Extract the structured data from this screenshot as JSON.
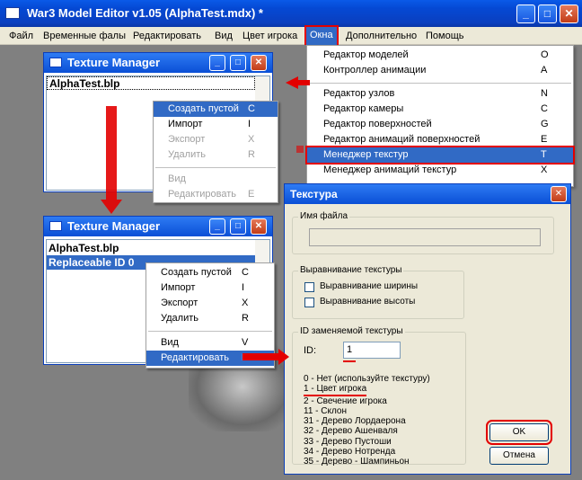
{
  "app": {
    "title": "War3 Model Editor v1.05 (AlphaTest.mdx) *",
    "window_controls": [
      "_",
      "□",
      "✕"
    ]
  },
  "menubar": [
    "Файл",
    "Временные фалы",
    "Редактировать",
    "Вид",
    "Цвет игрока",
    "Окна",
    "Дополнительно",
    "Помощь"
  ],
  "windows_menu": [
    {
      "label": "Редактор моделей",
      "key": "O"
    },
    {
      "label": "Контроллер анимации",
      "key": "A"
    },
    {
      "label": "Редактор узлов",
      "key": "N"
    },
    {
      "label": "Редактор камеры",
      "key": "C"
    },
    {
      "label": "Редактор поверхностей",
      "key": "G"
    },
    {
      "label": "Редактор анимаций поверхностей",
      "key": "E"
    },
    {
      "label": "Менеджер текстур",
      "key": "T"
    },
    {
      "label": "Менеджер анимаций текстур",
      "key": "X"
    }
  ],
  "tm1": {
    "title": "Texture Manager",
    "items": [
      "AlphaTest.blp"
    ],
    "ctx": [
      {
        "label": "Создать пустой",
        "key": "C"
      },
      {
        "label": "Импорт",
        "key": "I"
      },
      {
        "label": "Экспорт",
        "key": "X"
      },
      {
        "label": "Удалить",
        "key": "R"
      },
      {
        "label": "Вид",
        "key": ""
      },
      {
        "label": "Редактировать",
        "key": "E"
      }
    ]
  },
  "tm2": {
    "title": "Texture Manager",
    "items": [
      "AlphaTest.blp",
      "Replaceable ID 0"
    ],
    "ctx": [
      {
        "label": "Создать пустой",
        "key": "C"
      },
      {
        "label": "Импорт",
        "key": "I"
      },
      {
        "label": "Экспорт",
        "key": "X"
      },
      {
        "label": "Удалить",
        "key": "R"
      },
      {
        "label": "Вид",
        "key": "V"
      },
      {
        "label": "Редактировать",
        "key": "E"
      }
    ]
  },
  "tex": {
    "title": "Текстура",
    "filename_label": "Имя файла",
    "filename_value": "",
    "wrap_label": "Выравнивание текстуры",
    "wrap_width": "Выравнивание ширины",
    "wrap_height": "Выравнивание высоты",
    "rid_label": "ID заменяемой текстуры",
    "id_label": "ID:",
    "id_value": "1",
    "id_list": [
      "0 - Нет (используйте текстуру)",
      "1 - Цвет игрока",
      "2 - Свечение игрока",
      "11 - Склон",
      "31 - Дерево Лордаерона",
      "32 - Дерево Ашенваля",
      "33 - Дерево Пустоши",
      "34 - Дерево Нотренда",
      "35 - Дерево - Шампиньон"
    ],
    "ok": "OK",
    "cancel": "Отмена"
  },
  "colors": {
    "highlight": "#316ac5",
    "annotation": "#e30000"
  }
}
